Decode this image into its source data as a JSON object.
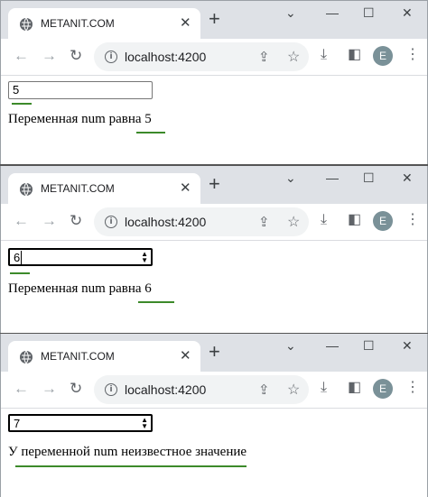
{
  "windows": [
    {
      "tab_title": "METANIT.COM",
      "url": "localhost:4200",
      "avatar_letter": "E",
      "input_value": "5",
      "message": "Переменная num равна 5"
    },
    {
      "tab_title": "METANIT.COM",
      "url": "localhost:4200",
      "avatar_letter": "E",
      "input_value": "6",
      "message": "Переменная num равна 6"
    },
    {
      "tab_title": "METANIT.COM",
      "url": "localhost:4200",
      "avatar_letter": "E",
      "input_value": "7",
      "message": "У переменной num неизвестное значение"
    }
  ],
  "icons": {
    "tab_icon": "globe-icon",
    "close": "close-icon",
    "new_tab": "plus-icon",
    "back": "arrow-left-icon",
    "forward": "arrow-right-icon",
    "reload": "reload-icon",
    "site_info": "info-icon",
    "share": "share-icon",
    "bookmark": "star-icon",
    "download": "download-icon",
    "side_panel": "side-panel-icon",
    "menu": "kebab-menu-icon"
  },
  "colors": {
    "titlebar": "#dee1e6",
    "omnibox": "#f1f3f4",
    "avatar": "#7a9198",
    "annotation_underline": "#3c8a2a"
  }
}
